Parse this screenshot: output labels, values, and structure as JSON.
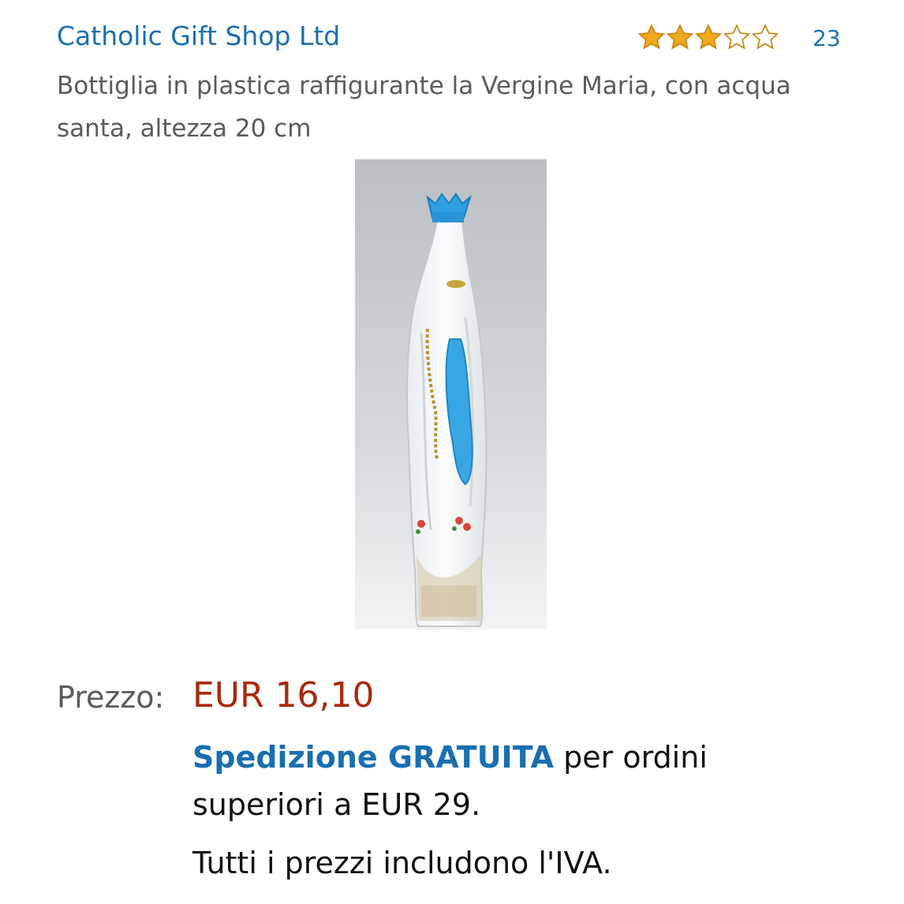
{
  "seller": {
    "name": "Catholic Gift Shop Ltd"
  },
  "rating": {
    "stars": 3,
    "max_stars": 5,
    "review_count": "23",
    "star_color": "#f0a81e",
    "star_outline_color": "#c58a12"
  },
  "product": {
    "title": "Bottiglia in plastica raffigurante la Vergine Maria, con acqua santa, altezza 20 cm",
    "image_icon": "virgin-mary-bottle-image"
  },
  "price": {
    "label": "Prezzo:",
    "value": "EUR 16,10",
    "color": "#a82a0c"
  },
  "shipping": {
    "free_label": "Spedizione GRATUITA",
    "rest": " per ordini superiori a EUR 29."
  },
  "vat_note": "Tutti i prezzi includono l'IVA.",
  "colors": {
    "link": "#1a6fb0",
    "text_secondary": "#5b5b5b"
  }
}
